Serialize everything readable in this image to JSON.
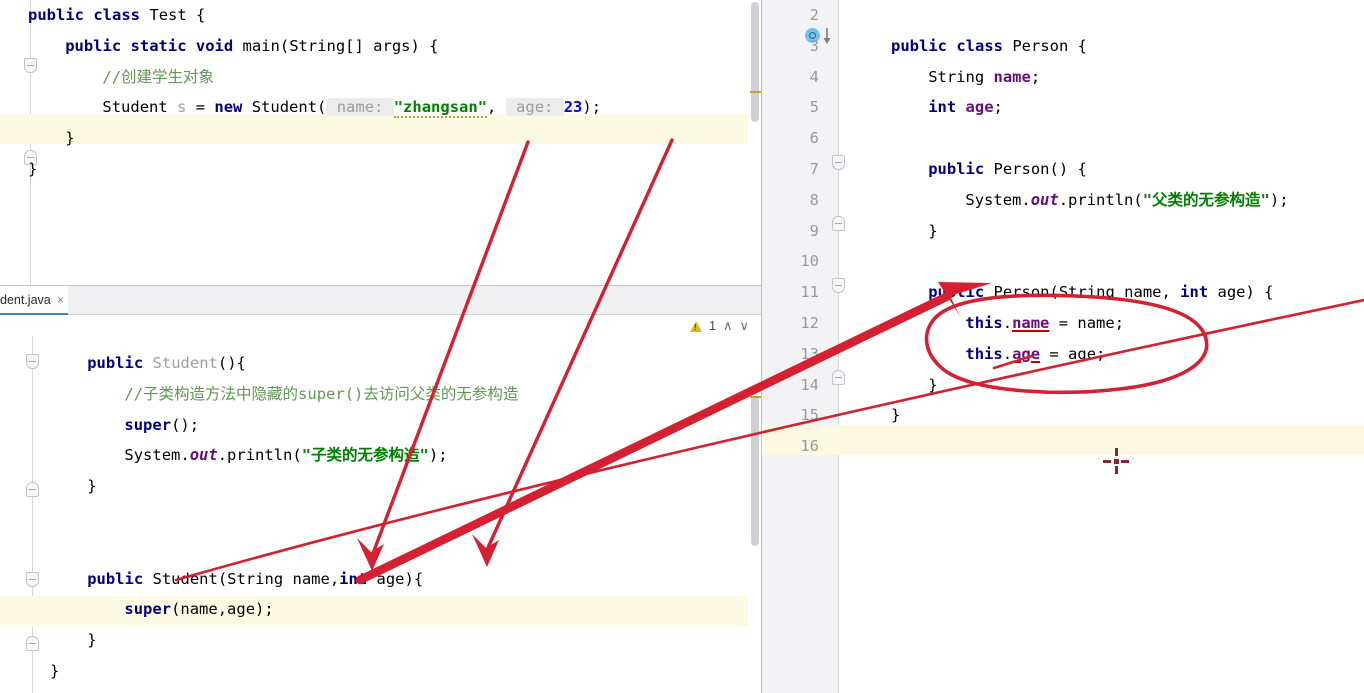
{
  "app": {
    "kind": "java-ide-code-editor",
    "colors": {
      "keyword": "#000080",
      "string": "#008000",
      "number": "#0000ff",
      "comment": "#629755",
      "field": "#660e7a",
      "unused_gray": "#a0a0a0",
      "caret_line": "#fcfae3",
      "gutter": "#f3f3f5",
      "annotation_red": "#d42030",
      "tab_underline": "#4083c9",
      "warning_yellow": "#e2b824"
    }
  },
  "left_top_editor": {
    "name": "Test.java editor",
    "lines": [
      {
        "indent": 0,
        "tokens": [
          {
            "t": "public",
            "c": "kw"
          },
          {
            "t": " ",
            "c": "plain"
          },
          {
            "t": "class",
            "c": "kw"
          },
          {
            "t": " ",
            "c": "plain"
          },
          {
            "t": "Test",
            "c": "typ"
          },
          {
            "t": " {",
            "c": "plain"
          }
        ]
      },
      {
        "indent": 1,
        "tokens": [
          {
            "t": "public",
            "c": "kw"
          },
          {
            "t": " ",
            "c": "plain"
          },
          {
            "t": "static",
            "c": "kw"
          },
          {
            "t": " ",
            "c": "plain"
          },
          {
            "t": "void",
            "c": "kw"
          },
          {
            "t": " main(String[] args) {",
            "c": "plain"
          }
        ]
      },
      {
        "indent": 2,
        "tokens": [
          {
            "t": "//创建学生对象",
            "c": "cmt"
          }
        ]
      },
      {
        "indent": 2,
        "highlight": true,
        "tokens": [
          {
            "t": "Student ",
            "c": "plain"
          },
          {
            "t": "s",
            "c": "gray"
          },
          {
            "t": " = ",
            "c": "plain"
          },
          {
            "t": "new",
            "c": "kw"
          },
          {
            "t": " Student(",
            "c": "plain"
          },
          {
            "t": " name: ",
            "c": "hint"
          },
          {
            "t": "\"zhangsan\"",
            "c": "str wavy"
          },
          {
            "t": ", ",
            "c": "plain"
          },
          {
            "t": " age: ",
            "c": "hint"
          },
          {
            "t": "23",
            "c": "num"
          },
          {
            "t": ");",
            "c": "plain"
          }
        ]
      },
      {
        "indent": 1,
        "tokens": [
          {
            "t": "}",
            "c": "plain"
          }
        ]
      },
      {
        "indent": 0,
        "tokens": [
          {
            "t": "}",
            "c": "plain"
          }
        ]
      }
    ]
  },
  "left_bottom_editor": {
    "name": "Student.java editor",
    "tab": {
      "label": "dent.java",
      "close": "×"
    },
    "inspection": {
      "warning_count": "1",
      "prev": "∧",
      "next": "∨"
    },
    "lines": [
      {
        "indent": 1,
        "tokens": [
          {
            "t": "public",
            "c": "kw"
          },
          {
            "t": " ",
            "c": "plain"
          },
          {
            "t": "Student",
            "c": "gray"
          },
          {
            "t": "(){",
            "c": "plain"
          }
        ]
      },
      {
        "indent": 2,
        "tokens": [
          {
            "t": "//子类构造方法中隐藏的super()去访问父类的无参构造",
            "c": "cmt"
          }
        ]
      },
      {
        "indent": 2,
        "tokens": [
          {
            "t": "super",
            "c": "kw"
          },
          {
            "t": "();",
            "c": "plain"
          }
        ]
      },
      {
        "indent": 2,
        "tokens": [
          {
            "t": "System.",
            "c": "plain"
          },
          {
            "t": "out",
            "c": "fldi"
          },
          {
            "t": ".println(",
            "c": "plain"
          },
          {
            "t": "\"子类的无参构造\"",
            "c": "str"
          },
          {
            "t": ");",
            "c": "plain"
          }
        ]
      },
      {
        "indent": 1,
        "tokens": [
          {
            "t": "}",
            "c": "plain"
          }
        ]
      },
      {
        "indent": 0,
        "tokens": [
          {
            "t": "",
            "c": "plain"
          }
        ]
      },
      {
        "indent": 0,
        "tokens": [
          {
            "t": "",
            "c": "plain"
          }
        ]
      },
      {
        "indent": 1,
        "tokens": [
          {
            "t": "public",
            "c": "kw"
          },
          {
            "t": " Student(String name,",
            "c": "plain"
          },
          {
            "t": "int",
            "c": "kw"
          },
          {
            "t": " age){",
            "c": "plain"
          }
        ]
      },
      {
        "indent": 2,
        "highlight": true,
        "tokens": [
          {
            "t": "super",
            "c": "kw"
          },
          {
            "t": "(name,age);",
            "c": "plain"
          }
        ]
      },
      {
        "indent": 1,
        "tokens": [
          {
            "t": "}",
            "c": "plain"
          }
        ]
      },
      {
        "indent": 0,
        "tokens": [
          {
            "t": "}",
            "c": "plain"
          }
        ]
      }
    ]
  },
  "right_editor": {
    "name": "Person.java editor",
    "gutter_icon": "subclass-implementation-icon",
    "gutter_icon_line": "3",
    "line_numbers": [
      "2",
      "3",
      "4",
      "5",
      "6",
      "7",
      "8",
      "9",
      "10",
      "11",
      "12",
      "13",
      "14",
      "15",
      "16"
    ],
    "lines": [
      {
        "num": "2",
        "indent": 0,
        "tokens": [
          {
            "t": "",
            "c": "plain"
          }
        ]
      },
      {
        "num": "3",
        "indent": 0,
        "tokens": [
          {
            "t": "public",
            "c": "kw"
          },
          {
            "t": " ",
            "c": "plain"
          },
          {
            "t": "class",
            "c": "kw"
          },
          {
            "t": " Person {",
            "c": "plain"
          }
        ]
      },
      {
        "num": "4",
        "indent": 1,
        "tokens": [
          {
            "t": "String ",
            "c": "plain"
          },
          {
            "t": "name",
            "c": "fld"
          },
          {
            "t": ";",
            "c": "plain"
          }
        ]
      },
      {
        "num": "5",
        "indent": 1,
        "tokens": [
          {
            "t": "int",
            "c": "kw"
          },
          {
            "t": " ",
            "c": "plain"
          },
          {
            "t": "age",
            "c": "fld"
          },
          {
            "t": ";",
            "c": "plain"
          }
        ]
      },
      {
        "num": "6",
        "indent": 0,
        "tokens": [
          {
            "t": "",
            "c": "plain"
          }
        ]
      },
      {
        "num": "7",
        "indent": 1,
        "tokens": [
          {
            "t": "public",
            "c": "kw"
          },
          {
            "t": " Person() {",
            "c": "plain"
          }
        ]
      },
      {
        "num": "8",
        "indent": 2,
        "tokens": [
          {
            "t": "System.",
            "c": "plain"
          },
          {
            "t": "out",
            "c": "fldi"
          },
          {
            "t": ".println(",
            "c": "plain"
          },
          {
            "t": "\"父类的无参构造\"",
            "c": "str"
          },
          {
            "t": ");",
            "c": "plain"
          }
        ]
      },
      {
        "num": "9",
        "indent": 1,
        "tokens": [
          {
            "t": "}",
            "c": "plain"
          }
        ]
      },
      {
        "num": "10",
        "indent": 0,
        "tokens": [
          {
            "t": "",
            "c": "plain"
          }
        ]
      },
      {
        "num": "11",
        "indent": 1,
        "tokens": [
          {
            "t": "public",
            "c": "kw"
          },
          {
            "t": " Person(String name, ",
            "c": "plain"
          },
          {
            "t": "int",
            "c": "kw"
          },
          {
            "t": " age) {",
            "c": "plain"
          }
        ]
      },
      {
        "num": "12",
        "indent": 2,
        "tokens": [
          {
            "t": "this",
            "c": "kw"
          },
          {
            "t": ".",
            "c": "plain"
          },
          {
            "t": "name",
            "c": "fld errunder"
          },
          {
            "t": " = name;",
            "c": "plain"
          }
        ]
      },
      {
        "num": "13",
        "indent": 2,
        "tokens": [
          {
            "t": "this",
            "c": "kw"
          },
          {
            "t": ".",
            "c": "plain"
          },
          {
            "t": "age",
            "c": "fld errunder"
          },
          {
            "t": " = age;",
            "c": "plain"
          }
        ]
      },
      {
        "num": "14",
        "indent": 1,
        "tokens": [
          {
            "t": "}",
            "c": "plain"
          }
        ]
      },
      {
        "num": "15",
        "indent": 0,
        "tokens": [
          {
            "t": "}",
            "c": "plain"
          }
        ]
      },
      {
        "num": "16",
        "indent": 0,
        "highlight": true,
        "tokens": [
          {
            "t": "",
            "c": "plain"
          }
        ]
      }
    ]
  },
  "annotations": {
    "description": "hand-drawn red pen markup linking constructor arguments to parameters and circling field assignments",
    "items": [
      {
        "name": "thin-line-from-zhangsan-to-name-param",
        "kind": "arrow"
      },
      {
        "name": "thin-line-from-23-to-age-param",
        "kind": "arrow"
      },
      {
        "name": "thick-arrow-to-person-constructor",
        "kind": "thick-arrow"
      },
      {
        "name": "thin-line-student-constructor-to-person-constructor",
        "kind": "line"
      },
      {
        "name": "ellipse-around-this-assignments",
        "kind": "ellipse"
      }
    ]
  },
  "caret_mark": {
    "name": "crosshair-cursor-mark"
  }
}
